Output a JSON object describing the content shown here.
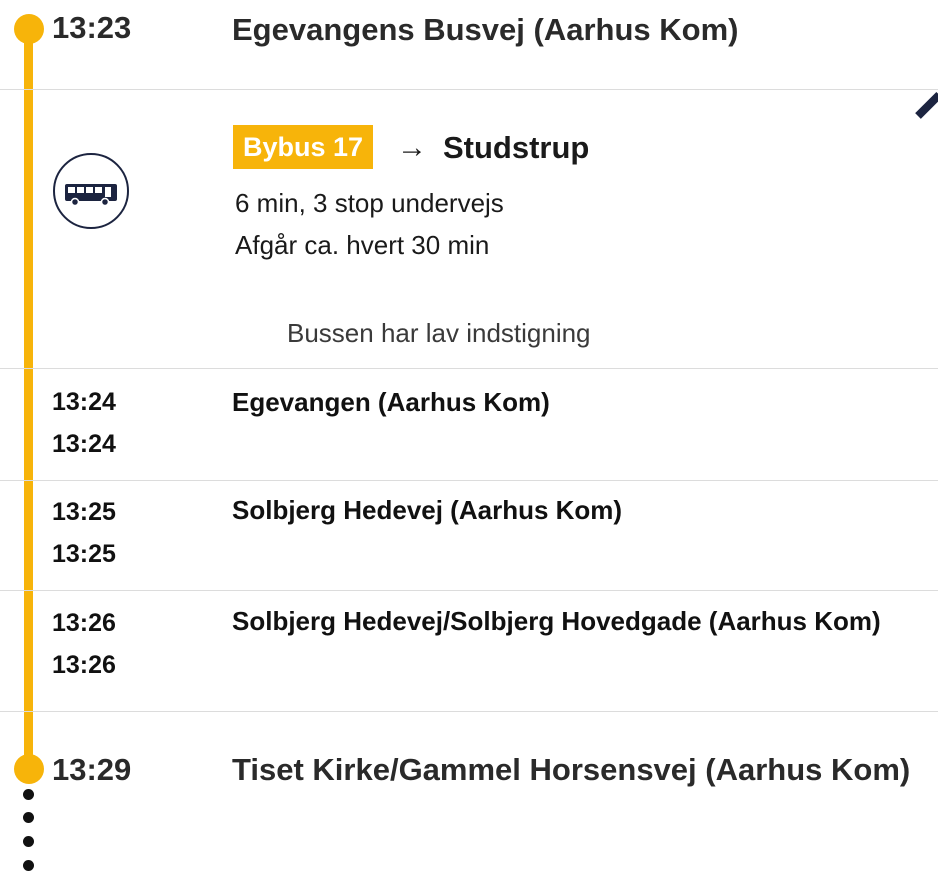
{
  "departure": {
    "time": "13:23",
    "stop": "Egevangens Busvej (Aarhus Kom)"
  },
  "leg": {
    "icon": "bus-icon",
    "line_label": "Bybus 17",
    "arrow": "→",
    "destination": "Studstrup",
    "duration_text": "6 min, 3 stop undervejs",
    "frequency_text": "Afgår ca. hvert 30 min",
    "accessibility_note": "Bussen har lav indstigning",
    "accent_color": "#f7b40a"
  },
  "intermediate_stops": [
    {
      "arrival": "13:24",
      "departure": "13:24",
      "name": "Egevangen (Aarhus Kom)"
    },
    {
      "arrival": "13:25",
      "departure": "13:25",
      "name": "Solbjerg Hedevej (Aarhus Kom)"
    },
    {
      "arrival": "13:26",
      "departure": "13:26",
      "name": "Solbjerg Hedevej/Solbjerg Hovedgade (Aarhus Kom)"
    }
  ],
  "arrival": {
    "time": "13:29",
    "stop": "Tiset Kirke/Gammel Horsensvej (Aarhus Kom)"
  }
}
